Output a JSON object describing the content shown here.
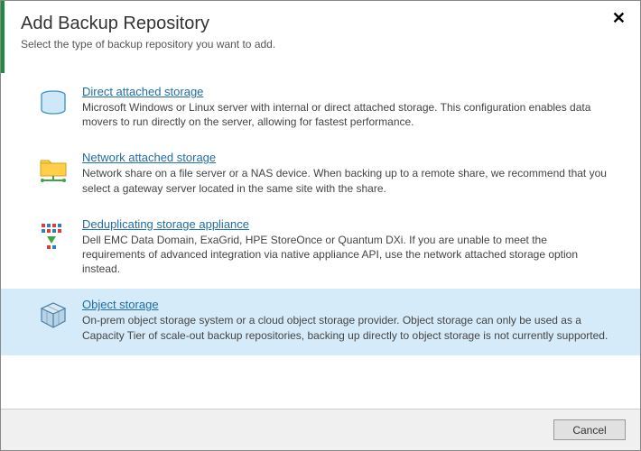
{
  "header": {
    "title": "Add Backup Repository",
    "subtitle": "Select the type of backup repository you want to add."
  },
  "options": [
    {
      "id": "direct-attached",
      "title": "Direct attached storage",
      "description": "Microsoft Windows or Linux server with internal or direct attached storage. This configuration enables data movers to run directly on the server, allowing for fastest performance.",
      "selected": false
    },
    {
      "id": "network-attached",
      "title": "Network attached storage",
      "description": "Network share on a file server or a NAS device. When backing up to a remote share, we recommend that you select a gateway server located in the same site with the share.",
      "selected": false
    },
    {
      "id": "dedup-appliance",
      "title": "Deduplicating storage appliance",
      "description": "Dell EMC Data Domain, ExaGrid, HPE StoreOnce or Quantum DXi. If you are unable to meet the requirements of advanced integration via native appliance API, use the network attached storage option instead.",
      "selected": false
    },
    {
      "id": "object-storage",
      "title": "Object storage",
      "description": "On-prem object storage system or a cloud object storage provider. Object storage can only be used as a Capacity Tier of scale-out backup repositories, backing up directly to object storage is not currently supported.",
      "selected": true
    }
  ],
  "footer": {
    "cancel_label": "Cancel"
  }
}
